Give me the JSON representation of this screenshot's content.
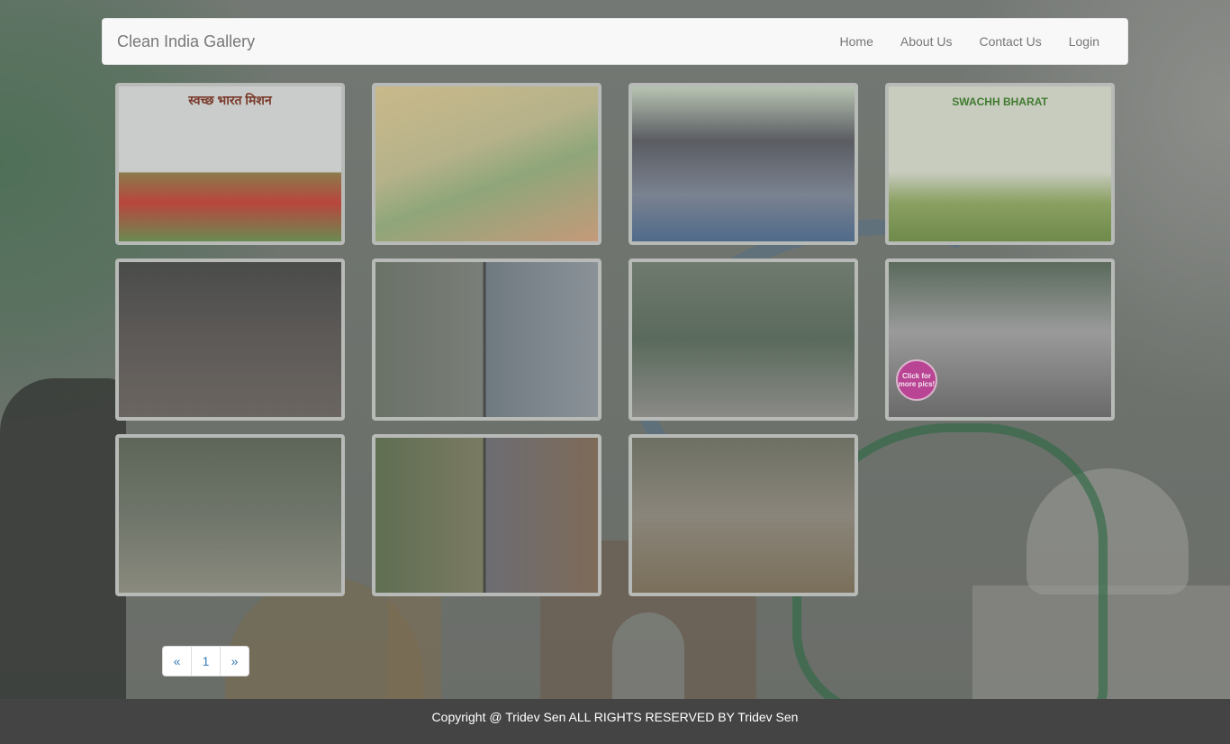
{
  "navbar": {
    "brand": "Clean India Gallery",
    "links": [
      "Home",
      "About Us",
      "Contact Us",
      "Login"
    ]
  },
  "gallery": {
    "items": [
      {
        "caption": "स्वच्छ भारत मिशन"
      },
      {
        "caption": ""
      },
      {
        "caption": ""
      },
      {
        "caption": "SWACHH BHARAT"
      },
      {
        "caption": ""
      },
      {
        "caption": ""
      },
      {
        "caption": ""
      },
      {
        "caption": "",
        "badge": "Click for more pics!"
      },
      {
        "caption": ""
      },
      {
        "caption": ""
      },
      {
        "caption": ""
      }
    ]
  },
  "pagination": {
    "prev": "«",
    "pages": [
      "1"
    ],
    "next": "»"
  },
  "footer": {
    "text": "Copyright @ Tridev Sen ALL RIGHTS RESERVED BY Tridev Sen"
  }
}
